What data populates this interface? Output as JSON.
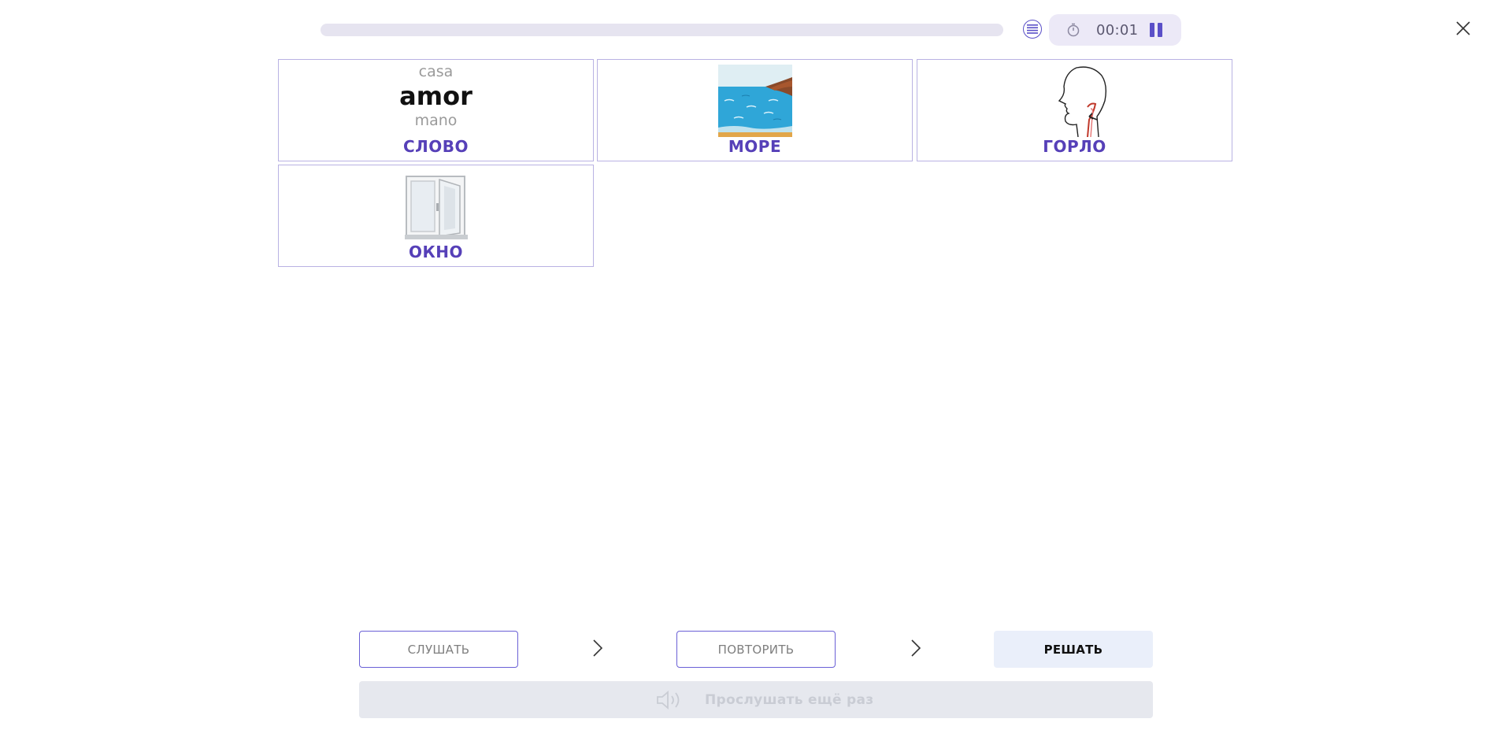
{
  "header": {
    "progress": 0,
    "timer": "00:01"
  },
  "cards": [
    {
      "label": "СЛОВО",
      "words": {
        "top": "casa",
        "middle": "amor",
        "bottom": "mano"
      }
    },
    {
      "label": "МОРЕ",
      "image": "sea-picture"
    },
    {
      "label": "ГОРЛО",
      "image": "throat-picture"
    },
    {
      "label": "ОКНО",
      "image": "window-picture"
    }
  ],
  "steps": {
    "listen": "СЛУШАТЬ",
    "repeat": "ПОВТОРИТЬ",
    "solve": "РЕШАТЬ"
  },
  "replay": {
    "label": "Прослушать ещё раз",
    "icon": "speaker-icon"
  },
  "colors": {
    "accent": "#5640b8",
    "card_border": "#b9b2e3",
    "progress_track": "#e6e4f0"
  }
}
